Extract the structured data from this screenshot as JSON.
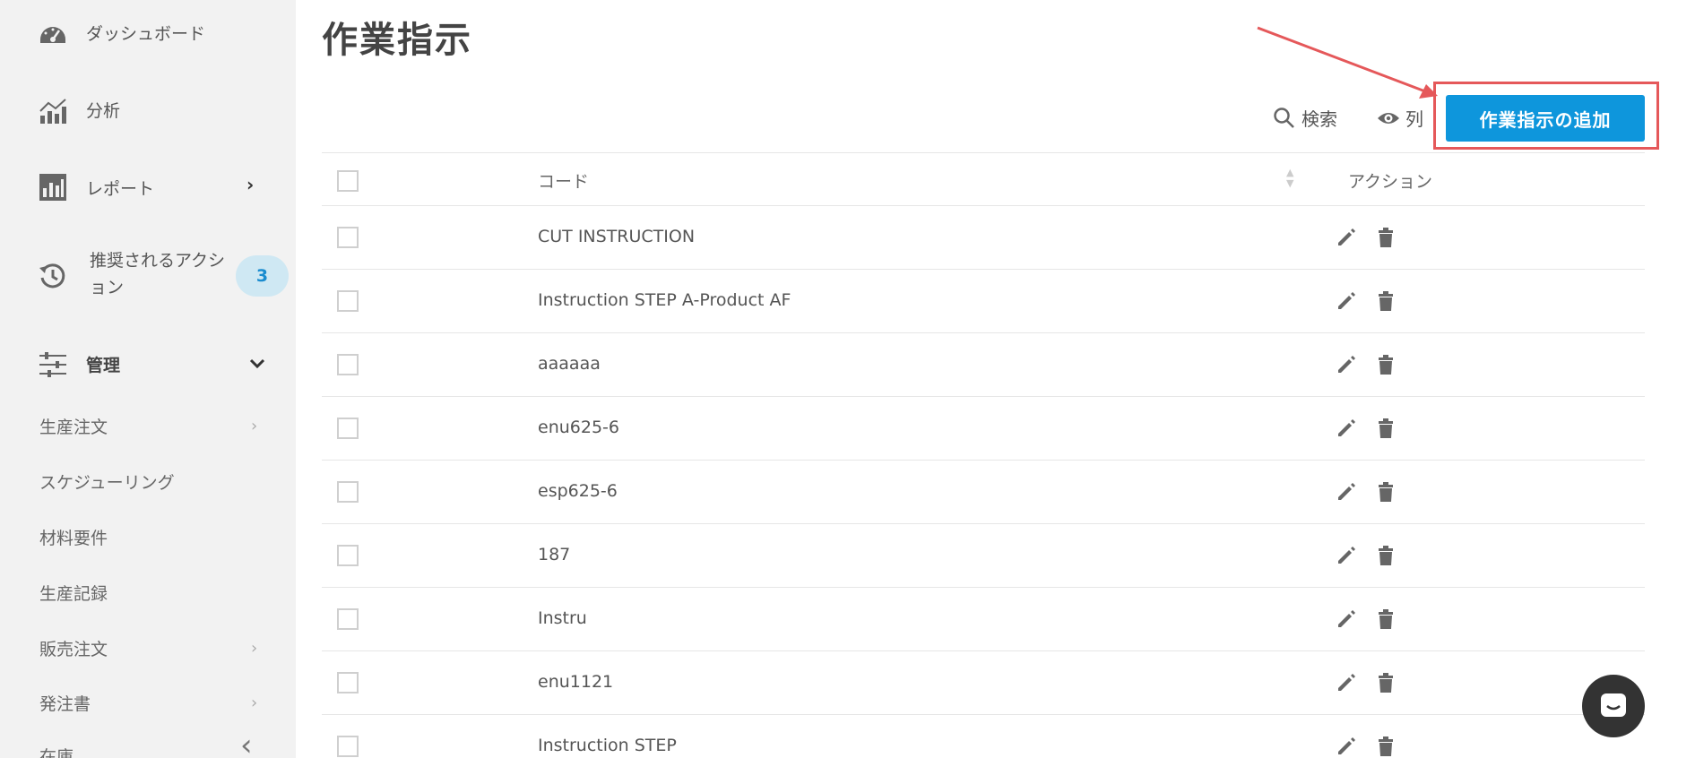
{
  "sidebar": {
    "items": [
      {
        "label": "ダッシュボード",
        "icon": "speedometer-icon"
      },
      {
        "label": "分析",
        "icon": "analytics-chart-icon"
      },
      {
        "label": "レポート",
        "icon": "report-chart-icon",
        "chevron": "›"
      },
      {
        "label": "推奨されるアクション",
        "icon": "history-icon",
        "badge": "3"
      },
      {
        "label": "管理",
        "icon": "sliders-icon",
        "chevron": "⌄"
      }
    ],
    "sub_items": [
      {
        "label": "生産注文",
        "chevron": "›"
      },
      {
        "label": "スケジューリング",
        "chevron": ""
      },
      {
        "label": "材料要件",
        "chevron": ""
      },
      {
        "label": "生産記録",
        "chevron": ""
      },
      {
        "label": "販売注文",
        "chevron": "›"
      },
      {
        "label": "発注書",
        "chevron": "›"
      },
      {
        "label": "在庫",
        "chevron": ""
      }
    ],
    "collapse": "‹"
  },
  "page": {
    "title": "作業指示"
  },
  "toolbar": {
    "search_label": "検索",
    "columns_label": "列",
    "add_label": "作業指示の追加"
  },
  "table": {
    "headers": {
      "code": "コード",
      "actions": "アクション"
    },
    "rows": [
      "CUT INSTRUCTION",
      "Instruction STEP A-Product AF",
      "aaaaaa",
      "enu625-6",
      "esp625-6",
      "187",
      "Instru",
      "enu1121",
      "Instruction STEP"
    ]
  },
  "colors": {
    "accent": "#0e96dc",
    "annotation": "#e5585a",
    "badge_bg": "#cfe8f3"
  }
}
